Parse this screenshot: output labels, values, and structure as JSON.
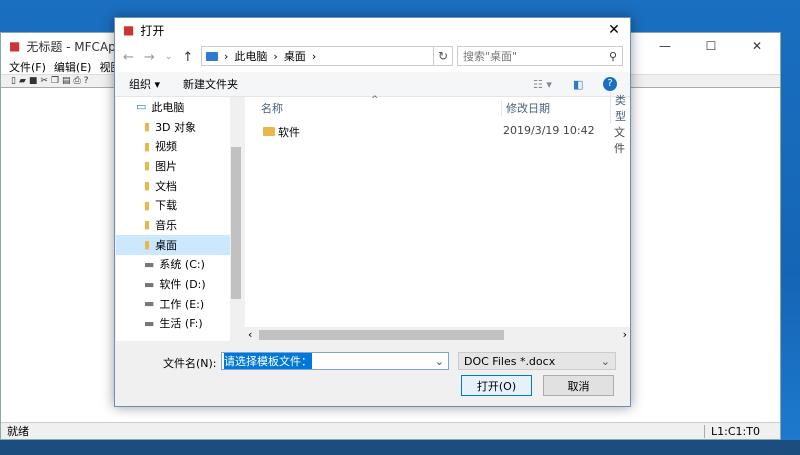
{
  "main_window": {
    "title": "无标题 - MFCAppli",
    "menu": [
      "文件(F)",
      "编辑(E)",
      "视图(V)"
    ],
    "status_left": "就绪",
    "status_right": "L1:C1:T0"
  },
  "dialog": {
    "title": "打开",
    "breadcrumb": [
      "此电脑",
      "桌面"
    ],
    "search_placeholder": "搜索\"桌面\"",
    "organize_label": "组织 ▾",
    "new_folder_label": "新建文件夹",
    "nav_items": [
      {
        "label": "此电脑",
        "icon": "computer-icon"
      },
      {
        "label": "3D 对象",
        "icon": "folder-icon"
      },
      {
        "label": "视频",
        "icon": "folder-icon"
      },
      {
        "label": "图片",
        "icon": "folder-icon"
      },
      {
        "label": "文档",
        "icon": "folder-icon"
      },
      {
        "label": "下载",
        "icon": "folder-icon"
      },
      {
        "label": "音乐",
        "icon": "folder-icon"
      },
      {
        "label": "桌面",
        "icon": "folder-icon",
        "selected": true
      },
      {
        "label": "系统 (C:)",
        "icon": "drive-icon"
      },
      {
        "label": "软件 (D:)",
        "icon": "drive-icon"
      },
      {
        "label": "工作 (E:)",
        "icon": "drive-icon"
      },
      {
        "label": "生活 (F:)",
        "icon": "drive-icon"
      }
    ],
    "columns": {
      "name": "名称",
      "modified": "修改日期",
      "type": "类型"
    },
    "files": [
      {
        "name": "软件",
        "modified": "2019/3/19 10:42",
        "type": "文件"
      }
    ],
    "filename_label": "文件名(N):",
    "filename_value": "请选择模板文件：",
    "filetype_value": "DOC Files *.docx",
    "open_label": "打开(O)",
    "cancel_label": "取消"
  }
}
